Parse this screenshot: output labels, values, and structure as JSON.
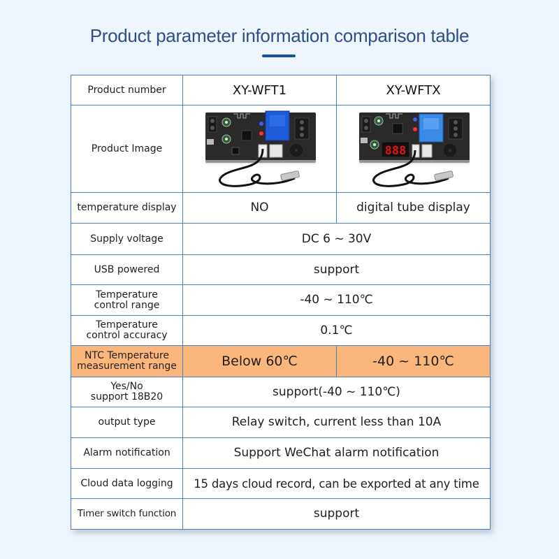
{
  "header": {
    "title": "Product parameter information comparison table"
  },
  "table": {
    "products": [
      "XY-WFT1",
      "XY-WFTX"
    ],
    "rows": {
      "product_number": {
        "label": "Product number"
      },
      "product_image": {
        "label": "Product Image",
        "images": [
          "relay-board-with-probe",
          "relay-board-with-digital-display-and-probe"
        ]
      },
      "temperature_display": {
        "label": "temperature display",
        "values": [
          "NO",
          "digital tube display"
        ]
      },
      "supply_voltage": {
        "label": "Supply voltage",
        "value": "DC 6 ~ 30V"
      },
      "usb_powered": {
        "label": "USB powered",
        "value": "support"
      },
      "control_range": {
        "label_line1": "Temperature",
        "label_line2": "control range",
        "value": "-40 ~ 110℃"
      },
      "control_accuracy": {
        "label_line1": "Temperature",
        "label_line2": "control accuracy",
        "value": "0.1℃"
      },
      "ntc_range": {
        "label_line1": "NTC Temperature",
        "label_line2": "measurement range",
        "values": [
          "Below 60℃",
          "-40 ~ 110℃"
        ],
        "highlight_color": "#fbb67c"
      },
      "support_18b20": {
        "label_line1": "Yes/No",
        "label_line2": "support 18B20",
        "value": "support(-40 ~ 110℃)"
      },
      "output_type": {
        "label": "output type",
        "value": "Relay switch, current less than 10A"
      },
      "alarm_notification": {
        "label": "Alarm notification",
        "value": "Support WeChat alarm notification"
      },
      "cloud_logging": {
        "label": "Cloud data logging",
        "value": "15 days cloud record, can be exported at any time"
      },
      "timer_switch": {
        "label": "Timer switch function",
        "value": "support"
      }
    }
  },
  "colors": {
    "title": "#2c4f86",
    "accent": "#1f4d9a",
    "border": "#4a7fc4",
    "background": "#eef5fd",
    "highlight": "#fbb67c"
  }
}
